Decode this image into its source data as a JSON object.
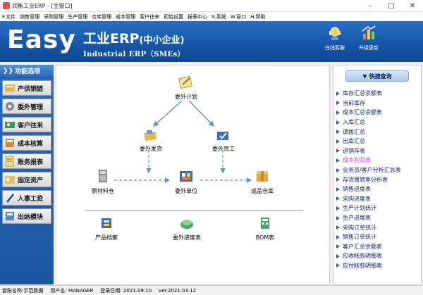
{
  "window": {
    "title": "润衡工业ERP - [主窗口]"
  },
  "menu": [
    "F.文件",
    "销售管理",
    "采购管理",
    "生产管理",
    "仓库管理",
    "成本管理",
    "客户往来",
    "初始设置",
    "报表中心",
    "S.系统",
    "W.窗口",
    "H.帮助"
  ],
  "banner": {
    "easy": "Easy",
    "cn_title": "工业ERP",
    "cn_sub": "(中小企业)",
    "en_title": "Industrial ERP（SMEs）",
    "online_service": "在线客服",
    "upgrade": "升级更新"
  },
  "sidebar": {
    "header": "功能选项",
    "items": [
      "产供销链",
      "委外管理",
      "客户往来",
      "成本核算",
      "账务报表",
      "固定资产",
      "人事工资",
      "出纳模块"
    ]
  },
  "flow": {
    "outsource_plan": "委外计划",
    "outsource_send": "委外发货",
    "outsource_done": "委外完工",
    "raw_warehouse": "原材料仓",
    "outsource_unit": "委外单位",
    "product_warehouse": "成品仓库",
    "product_file": "产品档案",
    "progress_table": "委外进度表",
    "bom_table": "BOM表"
  },
  "quick": {
    "header": "快捷查询",
    "items": [
      "库存汇总余额表",
      "当前库存",
      "成本汇总余额表",
      "入库汇总",
      "调拨汇总",
      "出库汇总",
      "进销存表",
      "成本利润表",
      "业务员/客户分析汇总表",
      "存货周转率分析表",
      "销售进度表",
      "采购进度表",
      "生产计划统计",
      "生产进度表",
      "采购订单统计",
      "销售订单统计",
      "客户汇总余额表",
      "应收帐款明细表",
      "应付帐款明细表"
    ],
    "active_index": 7
  },
  "status": {
    "account": "套账名称:示范数据",
    "user": "用户名: MANAGER",
    "login_date": "登录日期: 2021.09.10",
    "version": "ver.2021.03.12"
  },
  "colors": {
    "banner": "#1757a8",
    "quick_link": "#0b1f6e",
    "active_link": "#e03bd0",
    "flow_line": "#5a8fd0"
  }
}
